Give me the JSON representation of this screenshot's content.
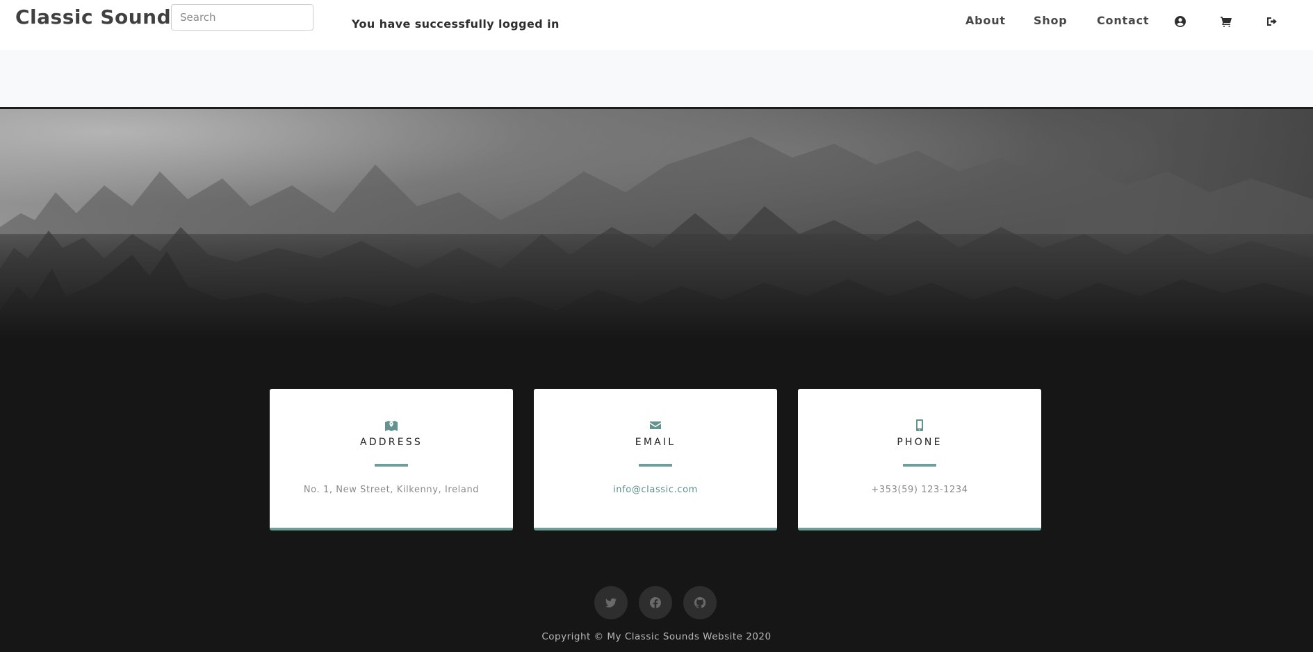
{
  "navbar": {
    "brand": "Classic Sounds",
    "search_placeholder": "Search",
    "message": "You have successfully logged in",
    "links": {
      "about": "About",
      "shop": "Shop",
      "contact": "Contact"
    },
    "icons": [
      "user-circle-icon",
      "shopping-cart-icon",
      "sign-out-icon"
    ]
  },
  "contact": {
    "cards": [
      {
        "icon": "map-marker-icon",
        "title": "ADDRESS",
        "value": "No. 1, New Street, Kilkenny, Ireland"
      },
      {
        "icon": "envelope-icon",
        "title": "EMAIL",
        "value": "info@classic.com"
      },
      {
        "icon": "mobile-icon",
        "title": "PHONE",
        "value": "+353(59) 123-1234"
      }
    ]
  },
  "social": {
    "icons": [
      "twitter-icon",
      "facebook-icon",
      "github-icon"
    ]
  },
  "footer": {
    "copyright": "Copyright © My Classic Sounds Website 2020"
  },
  "colors": {
    "accent": "#6e9e9a",
    "page_background": "#161616",
    "navbar_background": "#ffffff",
    "band_background": "#f8f9fa"
  }
}
